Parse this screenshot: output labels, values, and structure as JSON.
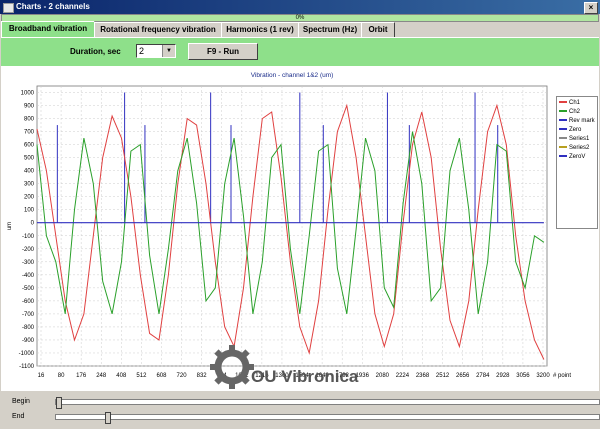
{
  "window": {
    "title": "Charts - 2 channels"
  },
  "progress": {
    "text": "0%",
    "value": 0
  },
  "tabs": [
    {
      "label": "Broadband vibration",
      "active": true
    },
    {
      "label": "Rotational frequency vibration",
      "active": false
    },
    {
      "label": "Harmonics (1 rev)",
      "active": false
    },
    {
      "label": "Spectrum (Hz)",
      "active": false
    },
    {
      "label": "Orbit",
      "active": false
    }
  ],
  "toolbar": {
    "duration_label": "Duration, sec",
    "duration_value": "2",
    "run_label": "F9 - Run"
  },
  "sliders": {
    "begin_label": "Begin",
    "end_label": "End",
    "begin_value": 0,
    "end_value": 0.09
  },
  "colors": {
    "ch1": "#e04040",
    "ch2": "#2aa02a",
    "rev_mark": "#3030c0",
    "zero": "#3030c0",
    "tab_active": "#8ee08a"
  },
  "watermark": {
    "text": "OU Vibronica"
  },
  "chart_data": {
    "type": "line",
    "title": "Vibration - channel 1&2 (um)",
    "ylabel": "um",
    "xlabel": "# point",
    "ylim": [
      -1100,
      1050
    ],
    "y_ticks": [
      "1000",
      "900",
      "800",
      "700",
      "600",
      "500",
      "400",
      "300",
      "200",
      "100",
      "0",
      "-100",
      "-200",
      "-300",
      "-400",
      "-500",
      "-600",
      "-700",
      "-800",
      "-900",
      "-1000",
      "-1100"
    ],
    "x_ticks": [
      "16",
      "80",
      "176",
      "248",
      "408",
      "512",
      "608",
      "720",
      "832",
      "944",
      "1072",
      "1216",
      "1360",
      "1504",
      "1648",
      "1792",
      "1936",
      "2080",
      "2224",
      "2368",
      "2512",
      "2656",
      "2784",
      "2928",
      "3056",
      "3200"
    ],
    "xlim": [
      0,
      3260
    ],
    "grid": true,
    "legend_position": "right",
    "legend": [
      "Ch1",
      "Ch2",
      "Rev mark",
      "Zero",
      "Series1",
      "Series2",
      "ZeroV"
    ],
    "rev_marks": [
      {
        "x": 130,
        "value": 750
      },
      {
        "x": 560,
        "value": 1000
      },
      {
        "x": 690,
        "value": 750
      },
      {
        "x": 1110,
        "value": 1000
      },
      {
        "x": 1240,
        "value": 750
      },
      {
        "x": 1680,
        "value": 1000
      },
      {
        "x": 1830,
        "value": 750
      },
      {
        "x": 2240,
        "value": 1000
      },
      {
        "x": 2380,
        "value": 750
      },
      {
        "x": 2800,
        "value": 1000
      },
      {
        "x": 2945,
        "value": 750
      }
    ],
    "series": [
      {
        "name": "Ch1",
        "x": [
          0,
          60,
          120,
          180,
          240,
          300,
          360,
          420,
          480,
          540,
          600,
          660,
          720,
          780,
          840,
          900,
          960,
          1020,
          1080,
          1140,
          1200,
          1260,
          1320,
          1380,
          1440,
          1500,
          1560,
          1620,
          1680,
          1740,
          1800,
          1860,
          1920,
          1980,
          2040,
          2100,
          2160,
          2220,
          2280,
          2340,
          2400,
          2460,
          2520,
          2580,
          2640,
          2700,
          2760,
          2820,
          2880,
          2940,
          3000,
          3060,
          3120,
          3180,
          3240
        ],
        "values": [
          720,
          400,
          -100,
          -600,
          -900,
          -700,
          -100,
          500,
          820,
          650,
          200,
          -400,
          -850,
          -900,
          -400,
          300,
          800,
          750,
          300,
          -300,
          -800,
          -950,
          -500,
          200,
          800,
          850,
          350,
          -300,
          -800,
          -1000,
          -600,
          100,
          700,
          900,
          500,
          -100,
          -700,
          -950,
          -700,
          0,
          600,
          850,
          500,
          -200,
          -750,
          -950,
          -600,
          100,
          700,
          900,
          600,
          -100,
          -600,
          -900,
          -1050
        ]
      },
      {
        "name": "Ch2",
        "x": [
          0,
          60,
          120,
          180,
          240,
          300,
          360,
          420,
          480,
          540,
          600,
          660,
          720,
          780,
          840,
          900,
          960,
          1020,
          1080,
          1140,
          1200,
          1260,
          1320,
          1380,
          1440,
          1500,
          1560,
          1620,
          1680,
          1740,
          1800,
          1860,
          1920,
          1980,
          2040,
          2100,
          2160,
          2220,
          2280,
          2340,
          2400,
          2460,
          2520,
          2580,
          2640,
          2700,
          2760,
          2820,
          2880,
          2940,
          3000,
          3060,
          3120,
          3180,
          3240
        ],
        "values": [
          600,
          -100,
          -300,
          -700,
          100,
          650,
          300,
          -450,
          -700,
          -300,
          550,
          600,
          -250,
          -700,
          -200,
          400,
          650,
          150,
          -600,
          -500,
          300,
          650,
          50,
          -700,
          -300,
          500,
          600,
          -200,
          -700,
          -100,
          550,
          600,
          -350,
          -700,
          -50,
          650,
          400,
          -500,
          -650,
          150,
          700,
          300,
          -600,
          -500,
          400,
          650,
          100,
          -700,
          -300,
          600,
          550,
          -300,
          -500,
          -100,
          -150
        ]
      },
      {
        "name": "Zero",
        "x": [
          0,
          3240
        ],
        "values": [
          0,
          0
        ]
      }
    ]
  }
}
